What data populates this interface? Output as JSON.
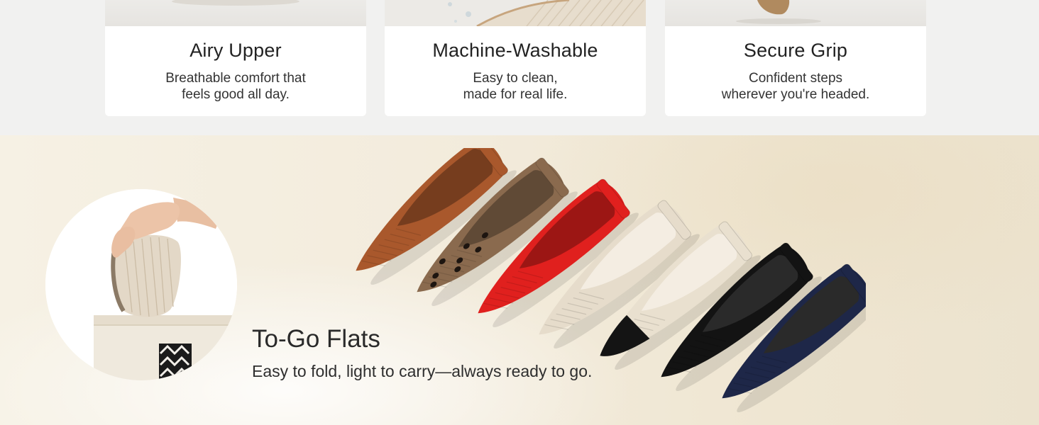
{
  "features": [
    {
      "title": "Airy Upper",
      "desc1": "Breathable comfort that",
      "desc2": "feels good all day."
    },
    {
      "title": "Machine-Washable",
      "desc1": "Easy to clean,",
      "desc2": "made for real life."
    },
    {
      "title": "Secure Grip",
      "desc1": "Confident steps",
      "desc2": "wherever you're headed."
    }
  ],
  "hero": {
    "title": "To-Go Flats",
    "subtitle": "Easy to fold, light to carry—always ready to go."
  },
  "shoe_colors": [
    "#a9582c",
    "#8a6a4e",
    "#e0201e",
    "#e6dccb",
    "#e9e0cf",
    "#131313",
    "#1e2748"
  ],
  "shoe_names": [
    "brown-shoe",
    "leopard-shoe",
    "red-shoe",
    "cream-shoe",
    "cap-toe-shoe",
    "black-shoe",
    "navy-shoe"
  ]
}
